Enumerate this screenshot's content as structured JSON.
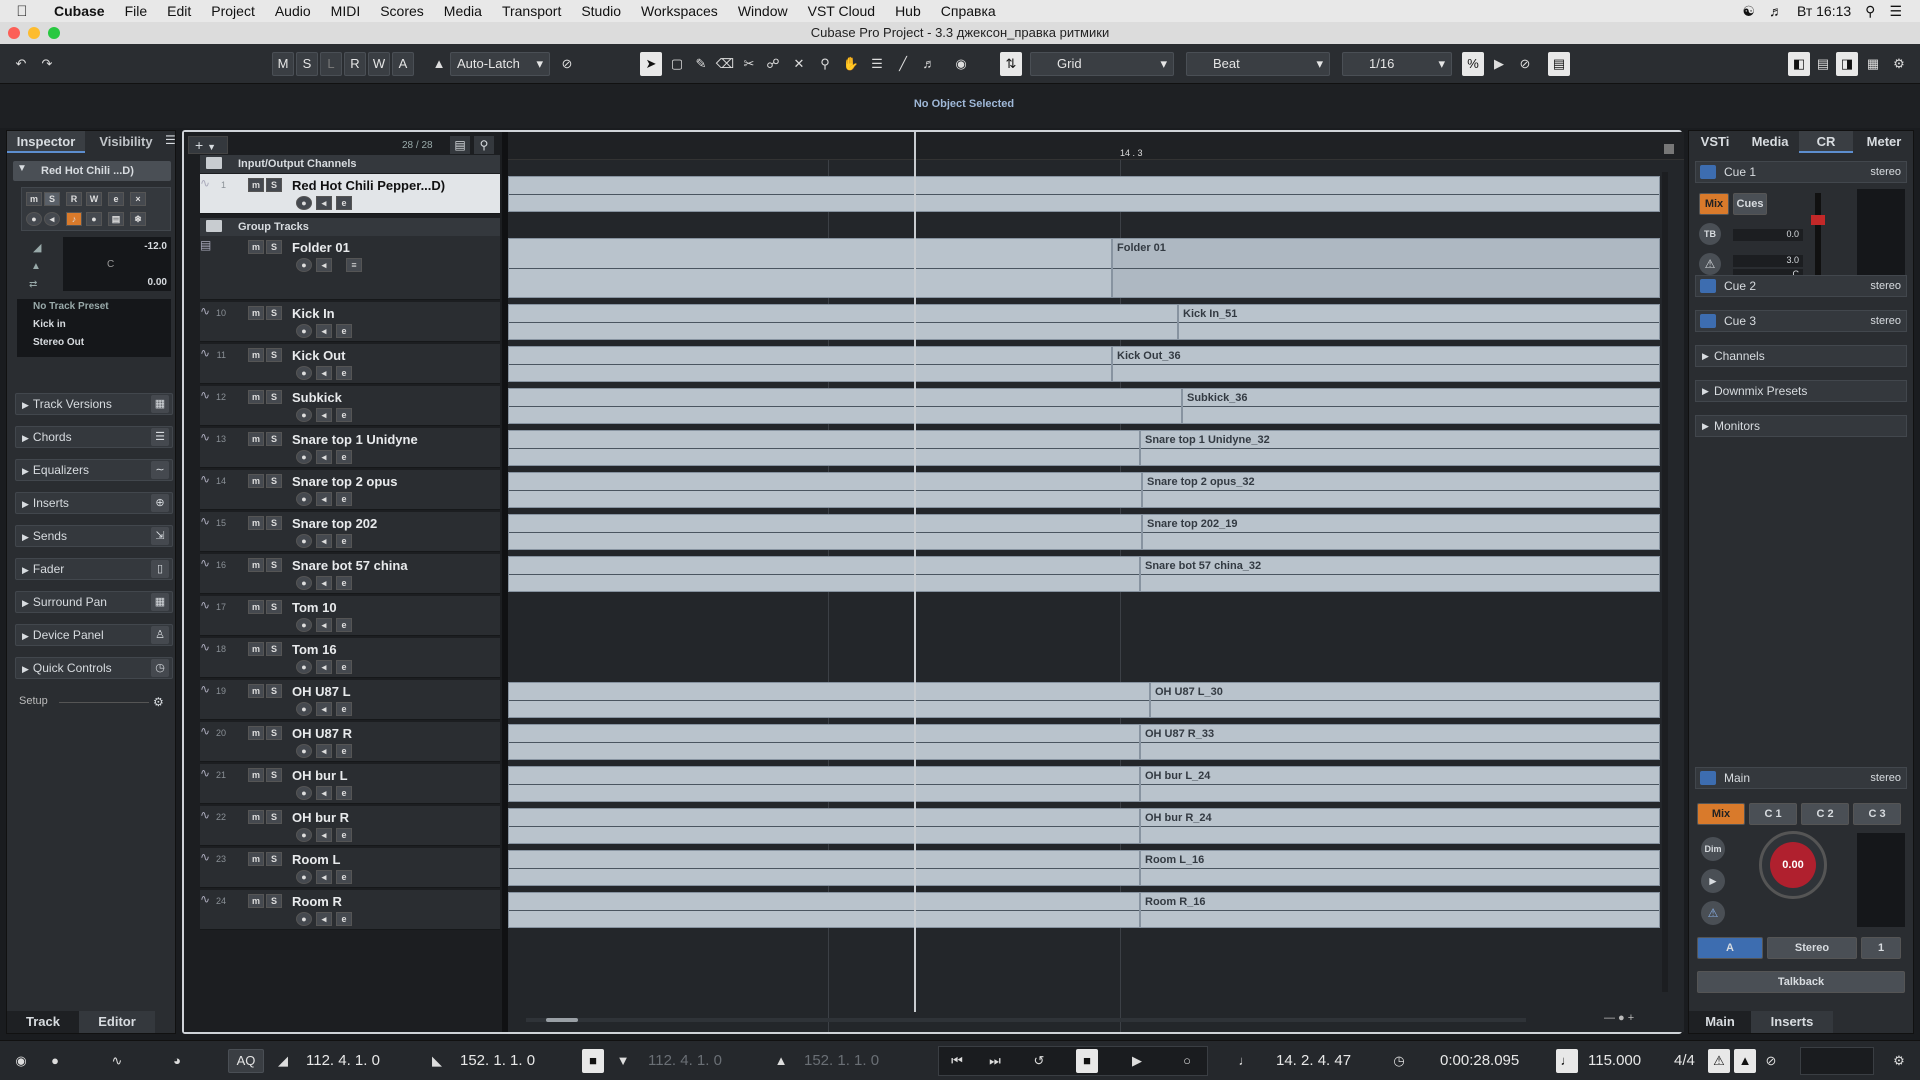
{
  "menubar": {
    "app": "Cubase",
    "items": [
      "File",
      "Edit",
      "Project",
      "Audio",
      "MIDI",
      "Scores",
      "Media",
      "Transport",
      "Studio",
      "Workspaces",
      "Window",
      "VST Cloud",
      "Hub",
      "Справка"
    ],
    "clock": "Вт 16:13"
  },
  "window": {
    "title": "Cubase Pro Project - 3.3 джексон_правка ритмики"
  },
  "toolbar": {
    "state_buttons": [
      "M",
      "S",
      "L",
      "R",
      "W",
      "A"
    ],
    "automation_mode": "Auto-Latch",
    "snap_type": "Grid",
    "grid_type": "Beat",
    "quantize": "1/16"
  },
  "infoline": {
    "status": "No Object Selected"
  },
  "inspector": {
    "tabs": [
      "Inspector",
      "Visibility"
    ],
    "track_name": "Red Hot Chili ...D)",
    "volume": "-12.0",
    "pan": "C",
    "delay": "0.00",
    "preset": "No Track Preset",
    "input": "Kick in",
    "output": "Stereo Out",
    "sections": [
      "Track Versions",
      "Chords",
      "Equalizers",
      "Inserts",
      "Sends",
      "Fader",
      "Surround Pan",
      "Device Panel",
      "Quick Controls"
    ],
    "setup": "Setup",
    "bottom_tabs": [
      "Track",
      "Editor"
    ]
  },
  "project": {
    "track_count": "28 / 28",
    "ruler_marker": "14 . 3",
    "folders": {
      "io": "Input/Output Channels",
      "group": "Group Tracks"
    },
    "tracks": [
      {
        "num": "1",
        "name": "Red Hot Chili Pepper...D)"
      },
      {
        "num": "",
        "name": "Folder 01",
        "event": "Folder 01"
      },
      {
        "num": "10",
        "name": "Kick In",
        "event": "Kick In_51"
      },
      {
        "num": "11",
        "name": "Kick Out",
        "event": "Kick Out_36"
      },
      {
        "num": "12",
        "name": "Subkick",
        "event": "Subkick_36"
      },
      {
        "num": "13",
        "name": "Snare top 1 Unidyne",
        "event": "Snare top 1 Unidyne_32"
      },
      {
        "num": "14",
        "name": "Snare top 2 opus",
        "event": "Snare top 2 opus_32"
      },
      {
        "num": "15",
        "name": "Snare top 202",
        "event": "Snare top 202_19"
      },
      {
        "num": "16",
        "name": "Snare bot 57 china",
        "event": "Snare bot 57 china_32"
      },
      {
        "num": "17",
        "name": "Tom 10",
        "event": ""
      },
      {
        "num": "18",
        "name": "Tom 16",
        "event": ""
      },
      {
        "num": "19",
        "name": "OH U87 L",
        "event": "OH U87 L_30"
      },
      {
        "num": "20",
        "name": "OH U87 R",
        "event": "OH U87 R_33"
      },
      {
        "num": "21",
        "name": "OH bur L",
        "event": "OH bur L_24"
      },
      {
        "num": "22",
        "name": "OH bur R",
        "event": "OH bur R_24"
      },
      {
        "num": "23",
        "name": "Room L",
        "event": "Room L_16"
      },
      {
        "num": "24",
        "name": "Room R",
        "event": "Room R_16"
      }
    ]
  },
  "rightzone": {
    "tabs": [
      "VSTi",
      "Media",
      "CR",
      "Meter"
    ],
    "cues": [
      {
        "name": "Cue 1",
        "mode": "stereo"
      },
      {
        "name": "Cue 2",
        "mode": "stereo"
      },
      {
        "name": "Cue 3",
        "mode": "stereo"
      }
    ],
    "cue_buttons": [
      "Mix",
      "Cues"
    ],
    "tb": "TB",
    "cue_level": "0.0",
    "cue_level2": "3.0",
    "cue_pan": "C",
    "sections": [
      "Channels",
      "Downmix Presets",
      "Monitors"
    ],
    "main": {
      "name": "Main",
      "mode": "stereo"
    },
    "main_buttons": [
      "Mix",
      "C 1",
      "C 2",
      "C 3"
    ],
    "dim": "Dim",
    "knob_value": "0.00",
    "speaker_buttons": [
      "A",
      "Stereo",
      "1"
    ],
    "talkback": "Talkback",
    "bottom_tabs": [
      "Main",
      "Inserts"
    ],
    "meter_scale": [
      "0",
      "12",
      "24",
      "36",
      "48"
    ]
  },
  "transport": {
    "aq": "AQ",
    "left_locator": "112. 4. 1.   0",
    "right_locator": "152. 1. 1.   0",
    "punch_in": "112. 4. 1.   0",
    "punch_out": "152. 1. 1.   0",
    "position_bars": "14. 2. 4. 47",
    "position_time": "0:00:28.095",
    "tempo": "115.000",
    "signature": "4/4"
  },
  "colors": {
    "accent": "#3d6db0",
    "mix_orange": "#d97a2b",
    "knob_red": "#b0202e",
    "event": "#b9c3cc"
  }
}
